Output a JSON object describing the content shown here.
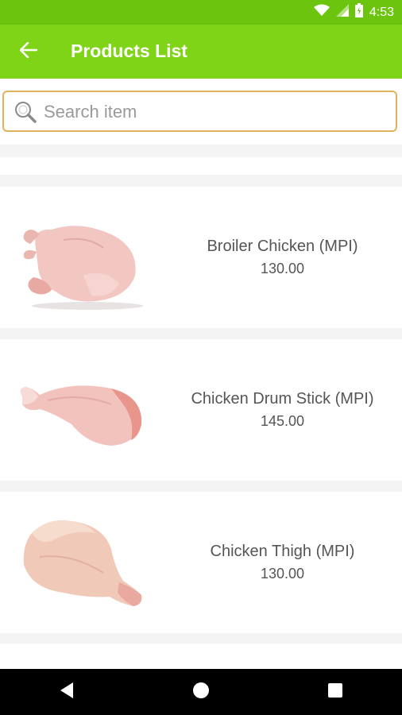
{
  "status_bar": {
    "time": "4:53"
  },
  "app_bar": {
    "title": "Products List"
  },
  "search": {
    "placeholder": "Search item"
  },
  "products": [
    {
      "name": "Broiler Chicken (MPI)",
      "price": "130.00"
    },
    {
      "name": "Chicken Drum Stick (MPI)",
      "price": "145.00"
    },
    {
      "name": "Chicken Thigh (MPI)",
      "price": "130.00"
    }
  ],
  "colors": {
    "status_bar": "#6cc40e",
    "app_bar": "#80d418",
    "search_border": "#e2b15b"
  },
  "icons": [
    "wifi-icon",
    "signal-icon",
    "battery-icon",
    "back-arrow-icon",
    "search-icon",
    "nav-back-icon",
    "nav-home-icon",
    "nav-recents-icon"
  ]
}
